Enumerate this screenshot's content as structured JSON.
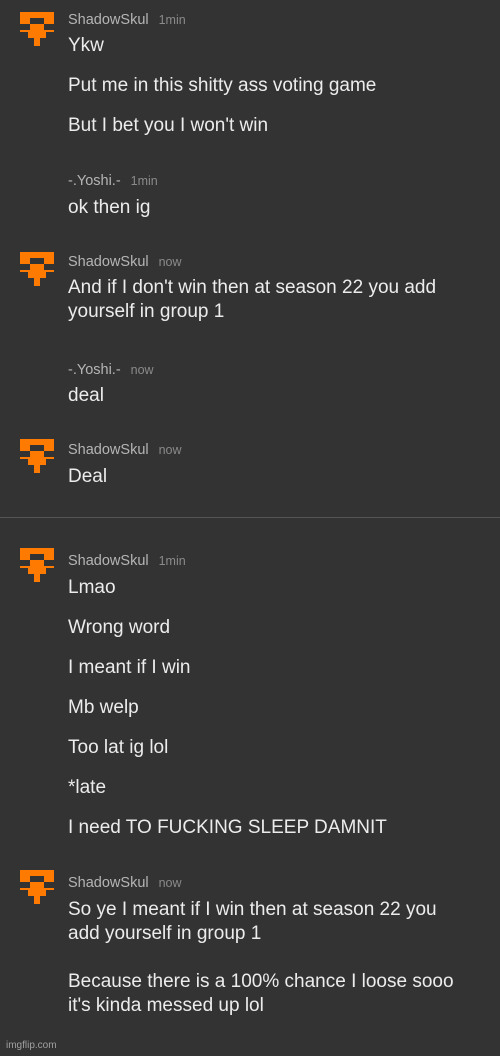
{
  "colors": {
    "accent": "#ff7a00",
    "background": "#333333"
  },
  "groups": [
    {
      "user": "ShadowSkul",
      "time": "1min",
      "avatar": "skull-icon",
      "messages": [
        "Ykw",
        "Put me in this shitty ass voting game",
        "But I bet you I won't win"
      ]
    },
    {
      "user": "-.Yoshi.-",
      "time": "1min",
      "avatar": null,
      "messages": [
        "ok then ig"
      ]
    },
    {
      "user": "ShadowSkul",
      "time": "now",
      "avatar": "skull-icon",
      "messages": [
        "And if I don't win then at season 22 you add\nyourself in group 1"
      ]
    },
    {
      "user": "-.Yoshi.-",
      "time": "now",
      "avatar": null,
      "messages": [
        "deal"
      ]
    },
    {
      "user": "ShadowSkul",
      "time": "now",
      "avatar": "skull-icon",
      "messages": [
        "Deal"
      ]
    },
    {
      "user": "ShadowSkul",
      "time": "1min",
      "avatar": "skull-icon",
      "messages": [
        "Lmao",
        "Wrong word",
        "I meant if I win",
        "Mb welp",
        "Too lat ig lol",
        "*late",
        "I need TO FUCKING SLEEP DAMNIT"
      ]
    },
    {
      "user": "ShadowSkul",
      "time": "now",
      "avatar": "skull-icon",
      "messages": [
        "So ye I meant if I win then at season 22 you\nadd yourself in group 1\n\nBecause there is a 100% chance I loose sooo\nit's kinda messed up lol"
      ]
    }
  ],
  "watermark": "imgflip.com"
}
